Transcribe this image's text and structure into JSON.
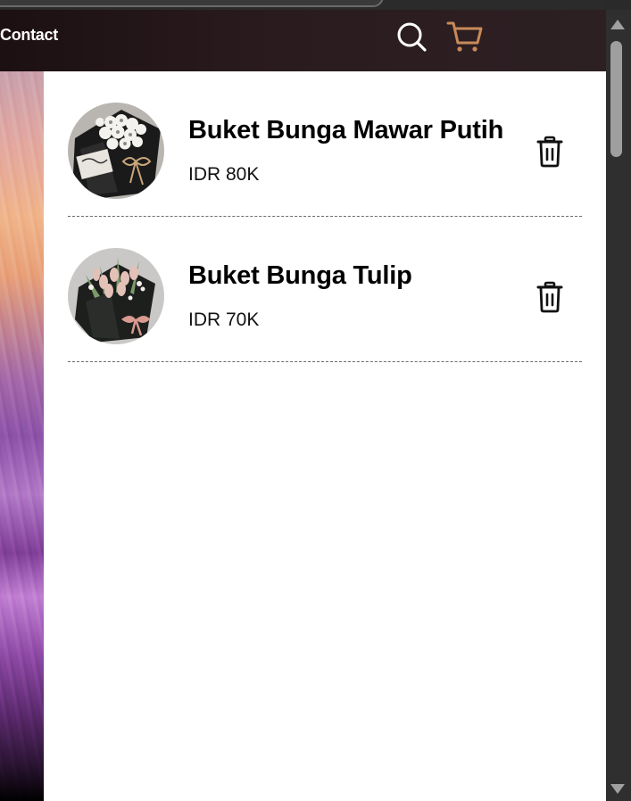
{
  "nav": {
    "contact_label": "Contact",
    "icons": [
      "search-icon",
      "cart-icon"
    ],
    "cart_icon_color": "#c88a5a",
    "search_icon_color": "#ffffff"
  },
  "cart": {
    "items": [
      {
        "name": "Buket Bunga Mawar Putih",
        "price": "IDR 80K",
        "image": "white-rose-bouquet",
        "remove_icon": "trash-icon"
      },
      {
        "name": "Buket Bunga Tulip",
        "price": "IDR 70K",
        "image": "tulip-bouquet",
        "remove_icon": "trash-icon"
      }
    ]
  },
  "colors": {
    "accent": "#c88a5a",
    "panel_background": "#ffffff",
    "navbar_background": "#2a1b1e"
  }
}
